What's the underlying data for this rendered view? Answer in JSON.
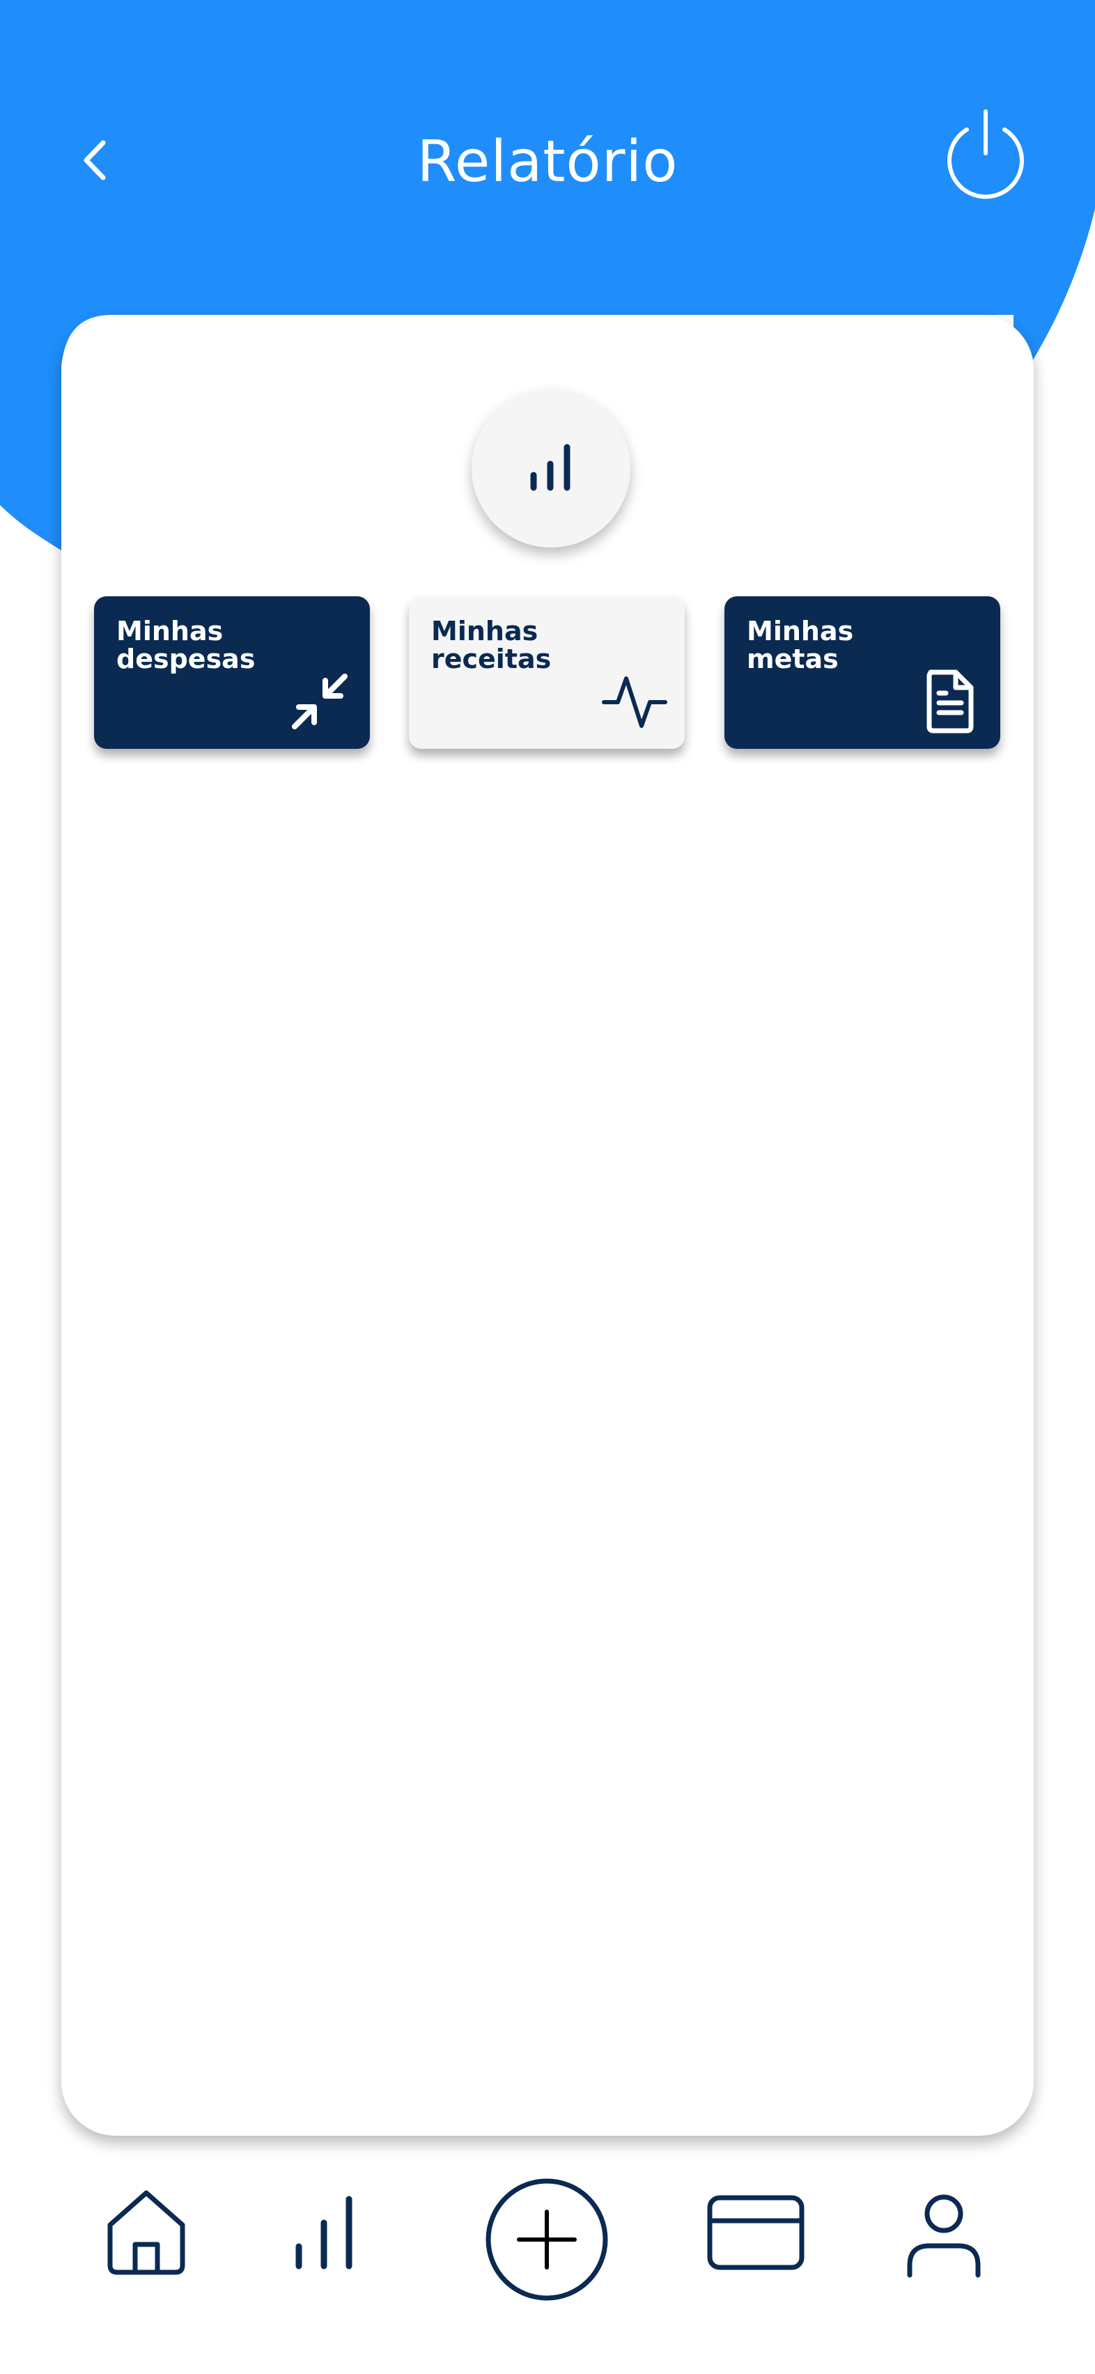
{
  "header": {
    "title": "Relatório",
    "back_icon": "chevron-left-icon",
    "power_icon": "power-icon"
  },
  "report_badge": {
    "icon": "bar-chart-icon"
  },
  "tiles": [
    {
      "label": "Minhas despesas",
      "icon": "arrows-collapse-icon",
      "style": "dark"
    },
    {
      "label": "Minhas receitas",
      "icon": "activity-pulse-icon",
      "style": "light"
    },
    {
      "label": "Minhas metas",
      "icon": "document-icon",
      "style": "dark"
    }
  ],
  "bottom_nav": [
    {
      "icon": "home-icon"
    },
    {
      "icon": "bar-chart-icon"
    },
    {
      "icon": "plus-circle-icon"
    },
    {
      "icon": "credit-card-icon"
    },
    {
      "icon": "user-icon"
    }
  ],
  "colors": {
    "primary_blue": "#1f8efa",
    "navy": "#0a2a52",
    "light_gray": "#f5f5f5",
    "white": "#ffffff"
  }
}
